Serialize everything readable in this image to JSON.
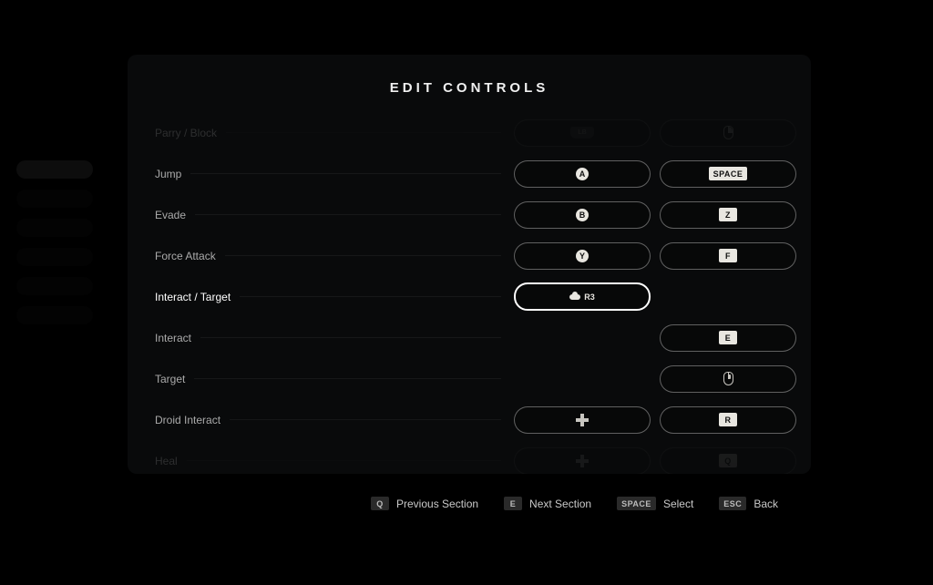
{
  "title": "EDIT CONTROLS",
  "rows": [
    {
      "label": "Parry / Block",
      "pad": {
        "type": "lb",
        "text": "LB"
      },
      "kbm": {
        "type": "mouse-rmb"
      },
      "dim": true
    },
    {
      "label": "Jump",
      "pad": {
        "type": "circle",
        "text": "A"
      },
      "kbm": {
        "type": "key",
        "text": "SPACE"
      }
    },
    {
      "label": "Evade",
      "pad": {
        "type": "circle",
        "text": "B"
      },
      "kbm": {
        "type": "key",
        "text": "Z"
      }
    },
    {
      "label": "Force Attack",
      "pad": {
        "type": "circle",
        "text": "Y"
      },
      "kbm": {
        "type": "key",
        "text": "F"
      }
    },
    {
      "label": "Interact / Target",
      "pad": {
        "type": "stick",
        "text": "R3"
      },
      "kbm": null,
      "selected": true
    },
    {
      "label": "Interact",
      "pad": null,
      "kbm": {
        "type": "key",
        "text": "E"
      }
    },
    {
      "label": "Target",
      "pad": null,
      "kbm": {
        "type": "mouse-mmb"
      }
    },
    {
      "label": "Droid Interact",
      "pad": {
        "type": "dpad"
      },
      "kbm": {
        "type": "key",
        "text": "R"
      }
    },
    {
      "label": "Heal",
      "pad": {
        "type": "dpad"
      },
      "kbm": {
        "type": "key",
        "text": "Q"
      },
      "dim": true
    }
  ],
  "footer": [
    {
      "key": "Q",
      "label": "Previous Section"
    },
    {
      "key": "E",
      "label": "Next Section"
    },
    {
      "key": "SPACE",
      "label": "Select"
    },
    {
      "key": "ESC",
      "label": "Back"
    }
  ],
  "sidebar_items": 6,
  "sidebar_active": 0
}
